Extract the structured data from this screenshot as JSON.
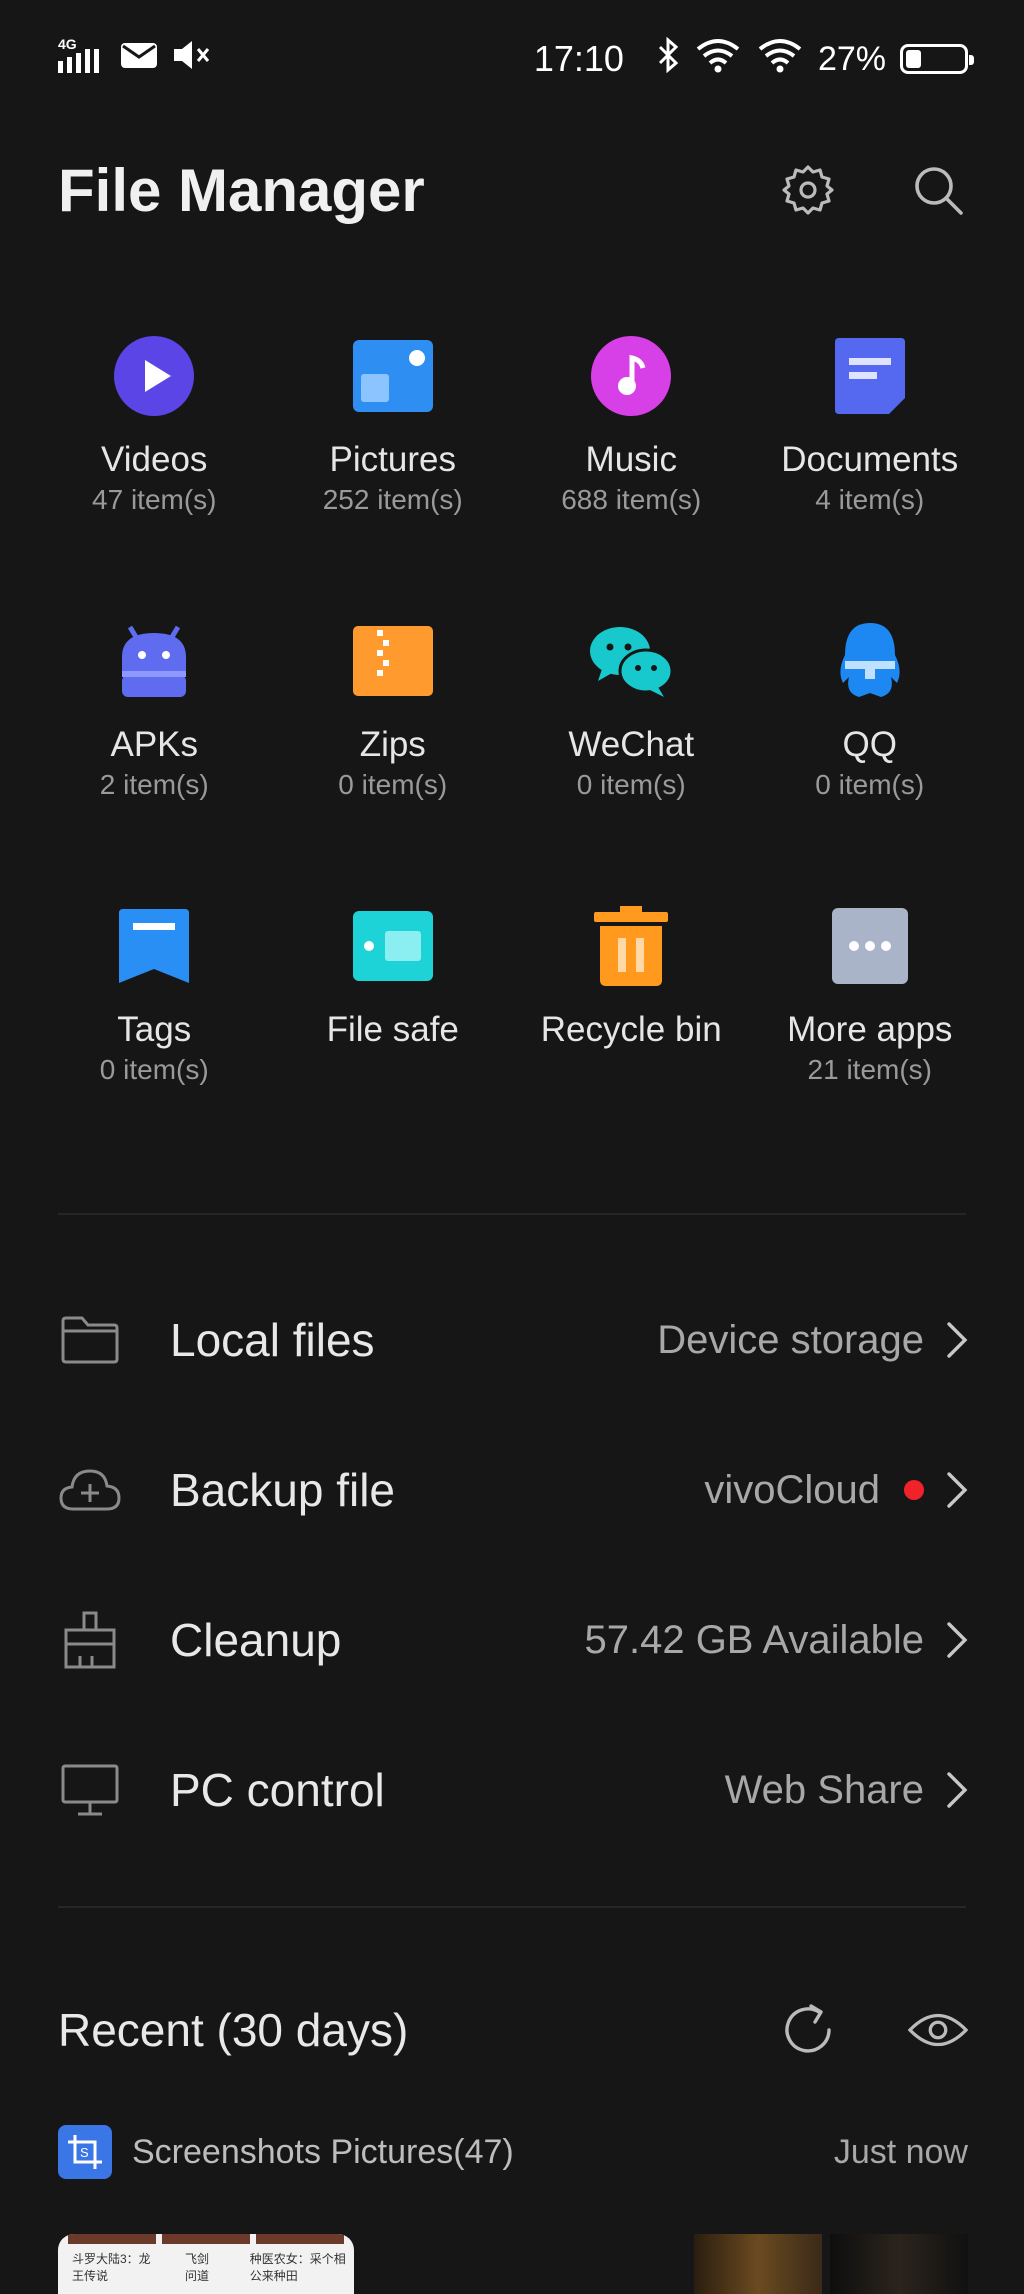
{
  "status_bar": {
    "network": "4G",
    "time": "17:10",
    "battery": "27%",
    "battery_level": 0.27
  },
  "header": {
    "title": "File Manager",
    "settings_icon": "gear-icon",
    "search_icon": "search-icon"
  },
  "categories": [
    {
      "label": "Videos",
      "count": "47 item(s)",
      "icon": "play-icon",
      "color": "#5b45e6"
    },
    {
      "label": "Pictures",
      "count": "252 item(s)",
      "icon": "picture-icon",
      "color": "#2f8ef2"
    },
    {
      "label": "Music",
      "count": "688 item(s)",
      "icon": "music-note-icon",
      "color": "#d740e6"
    },
    {
      "label": "Documents",
      "count": "4 item(s)",
      "icon": "document-icon",
      "color": "#5568f0"
    },
    {
      "label": "APKs",
      "count": "2 item(s)",
      "icon": "android-icon",
      "color": "#5f6cf0"
    },
    {
      "label": "Zips",
      "count": "0 item(s)",
      "icon": "zip-icon",
      "color": "#ff9a2e"
    },
    {
      "label": "WeChat",
      "count": "0 item(s)",
      "icon": "wechat-icon",
      "color": "#17c9cc"
    },
    {
      "label": "QQ",
      "count": "0 item(s)",
      "icon": "qq-icon",
      "color": "#1e88f2"
    },
    {
      "label": "Tags",
      "count": "0 item(s)",
      "icon": "tag-icon",
      "color": "#2a8ff5"
    },
    {
      "label": "File safe",
      "count": "",
      "icon": "safe-icon",
      "color": "#1ed3d8"
    },
    {
      "label": "Recycle bin",
      "count": "",
      "icon": "trash-icon",
      "color": "#ff9a1e"
    },
    {
      "label": "More apps",
      "count": "21 item(s)",
      "icon": "more-icon",
      "color": "#aab4c8"
    }
  ],
  "rows": [
    {
      "label": "Local files",
      "value": "Device storage",
      "icon": "folder-icon"
    },
    {
      "label": "Backup file",
      "value": "vivoCloud",
      "icon": "cloud-icon",
      "red_dot": true
    },
    {
      "label": "Cleanup",
      "value": "57.42 GB Available",
      "icon": "broom-icon"
    },
    {
      "label": "PC control",
      "value": "Web Share",
      "icon": "monitor-icon"
    }
  ],
  "recent": {
    "title": "Recent (30 days)",
    "group_label": "Screenshots Pictures(47)",
    "group_time": "Just now",
    "thumb_texts": [
      "斗罗大陆3：龙王传说",
      "飞剑问道",
      "种医农女：采个相公来种田"
    ]
  }
}
